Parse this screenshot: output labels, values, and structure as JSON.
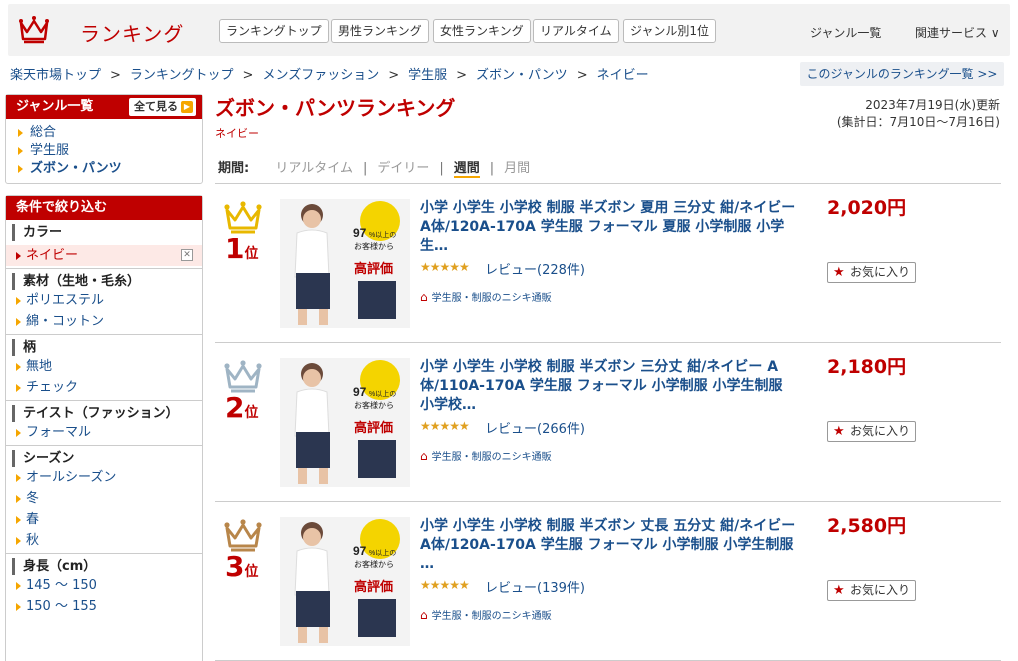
{
  "header": {
    "logo_text": "ランキング",
    "nav": [
      "ランキングトップ",
      "男性ランキング",
      "女性ランキング",
      "リアルタイム",
      "ジャンル別1位"
    ],
    "links": [
      "ジャンル一覧",
      "関連サービス ∨"
    ]
  },
  "breadcrumb": {
    "items": [
      "楽天市場トップ",
      "ランキングトップ",
      "メンズファッション",
      "学生服",
      "ズボン・パンツ",
      "ネイビー"
    ],
    "separator": ">"
  },
  "genre_list_link": "このジャンルのランキング一覧 >>",
  "sidebar": {
    "genre": {
      "title": "ジャンル一覧",
      "see_all": "全て見る",
      "items": [
        "総合",
        "学生服",
        "ズボン・パンツ"
      ]
    },
    "filter_title": "条件で絞り込む",
    "filters": [
      {
        "title": "カラー",
        "items": [
          "ネイビー"
        ],
        "selected": "ネイビー"
      },
      {
        "title": "素材（生地・毛糸）",
        "items": [
          "ポリエステル",
          "綿・コットン"
        ]
      },
      {
        "title": "柄",
        "items": [
          "無地",
          "チェック"
        ]
      },
      {
        "title": "テイスト（ファッション）",
        "items": [
          "フォーマル"
        ]
      },
      {
        "title": "シーズン",
        "items": [
          "オールシーズン",
          "冬",
          "春",
          "秋"
        ]
      },
      {
        "title": "身長（cm）",
        "items": [
          "145 〜 150",
          "150 〜 155"
        ]
      }
    ]
  },
  "main": {
    "title": "ズボン・パンツランキング",
    "subtitle": "ネイビー",
    "updated": "2023年7月19日(水)更新",
    "period_range": "(集計日：7月10日〜7月16日)",
    "period_label": "期間:",
    "periods": [
      "リアルタイム",
      "デイリー",
      "週間",
      "月間"
    ],
    "current_period": "週間",
    "bar": "|",
    "fav_label": "お気に入り",
    "rank_suffix": "位"
  },
  "products": [
    {
      "rank": "1",
      "title": "小学 小学生 小学校 制服 半ズボン 夏用 三分丈 紺/ネイビー A体/120A-170A 学生服 フォーマル 夏服 小学制服 小学生…",
      "price": "2,020円",
      "stars": "★★★★★",
      "review": "レビュー(228件)",
      "shop": "学生服・制服のニシキ通販",
      "crown_color": "#e8b800"
    },
    {
      "rank": "2",
      "title": "小学 小学生 小学校 制服 半ズボン 三分丈 紺/ネイビー A体/110A-170A 学生服 フォーマル 小学制服 小学生制服 小学校…",
      "price": "2,180円",
      "stars": "★★★★★",
      "review": "レビュー(266件)",
      "shop": "学生服・制服のニシキ通販",
      "crown_color": "#9fb4c4"
    },
    {
      "rank": "3",
      "title": "小学 小学生 小学校 制服 半ズボン 丈長 五分丈 紺/ネイビー A体/120A-170A 学生服 フォーマル 小学制服 小学生制服 …",
      "price": "2,580円",
      "stars": "★★★★★",
      "review": "レビュー(139件)",
      "shop": "学生服・制服のニシキ通販",
      "crown_color": "#b8864a"
    }
  ],
  "thumb_text": {
    "pct": "97",
    "unit": "%以上の",
    "line2": "お客様から",
    "line3": "高評価"
  }
}
